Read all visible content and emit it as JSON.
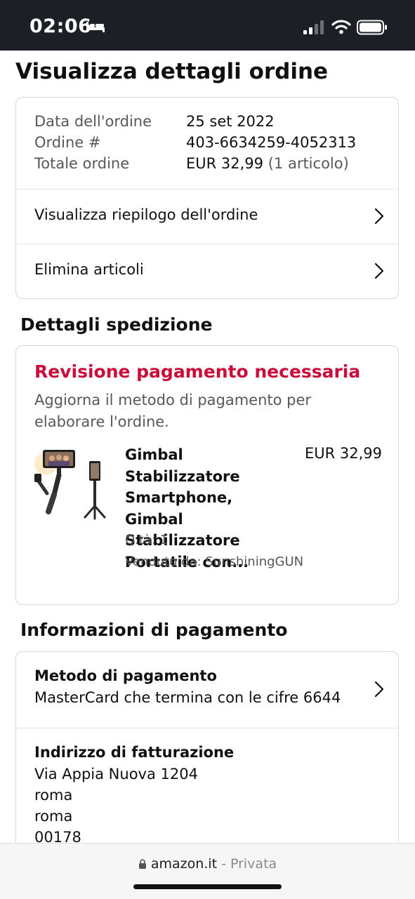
{
  "status_bar": {
    "time": "02:06"
  },
  "page": {
    "title": "Visualizza dettagli ordine"
  },
  "order_summary": {
    "date_label": "Data dell'ordine",
    "date_value": "25 set 2022",
    "number_label": "Ordine #",
    "number_value": "403-6634259-4052313",
    "total_label": "Totale ordine",
    "total_value": "EUR 32,99",
    "total_items": "(1 articolo)",
    "links": [
      {
        "label": "Visualizza riepilogo dell'ordine"
      },
      {
        "label": "Elimina articoli"
      }
    ]
  },
  "shipping": {
    "section_title": "Dettagli spedizione",
    "alert_title": "Revisione pagamento necessaria",
    "alert_body": "Aggiorna il metodo di pagamento per elaborare l'ordine.",
    "alert_color": "#cc0c39",
    "product": {
      "title_lines": [
        "Gimbal Stabilizzatore",
        "Smartphone, Gimbal",
        "Stabilizzatore",
        "Portatile con..."
      ],
      "price": "EUR 32,99",
      "quantity": "Q.tà: 1",
      "seller": "Venduto da: SunshiningGUN"
    }
  },
  "payment": {
    "section_title": "Informazioni di pagamento",
    "method_label": "Metodo di pagamento",
    "method_value": "MasterCard che termina con le cifre 6644",
    "billing_label": "Indirizzo di fatturazione",
    "billing_lines": [
      "Via Appia Nuova 1204",
      "roma",
      "roma",
      "00178"
    ]
  },
  "browser_bar": {
    "domain": "amazon.it",
    "separator": " - ",
    "mode": "Privata"
  },
  "icons": {
    "status": [
      "bed-icon",
      "signal-icon",
      "wifi-icon",
      "battery-icon"
    ],
    "row": "chevron-right-icon",
    "url": "lock-icon"
  }
}
